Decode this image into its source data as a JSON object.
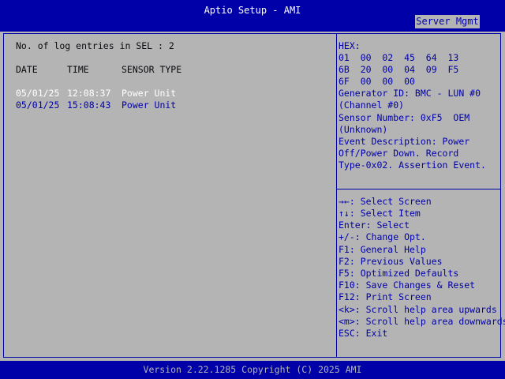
{
  "header": {
    "title": "Aptio Setup - AMI",
    "tab": "Server Mgmt"
  },
  "sel": {
    "count_label": "No. of log entries in SEL : 2",
    "columns": {
      "date": "DATE",
      "time": "TIME",
      "sensor": "SENSOR TYPE"
    },
    "entries": [
      {
        "date": "05/01/25",
        "time": "12:08:37",
        "sensor": "Power Unit"
      },
      {
        "date": "05/01/25",
        "time": "15:08:43",
        "sensor": "Power Unit"
      }
    ]
  },
  "details": {
    "lines": [
      "HEX:",
      "01  00  02  45  64  13",
      "6B  20  00  04  09  F5",
      "6F  00  00  00",
      "Generator ID: BMC - LUN #0",
      "(Channel #0)",
      "Sensor Number: 0xF5  OEM",
      "(Unknown)",
      "Event Description: Power",
      "Off/Power Down. Record",
      "Type-0x02. Assertion Event."
    ]
  },
  "keys": {
    "lines": [
      "→←: Select Screen",
      "↑↓: Select Item",
      "Enter: Select",
      "+/-: Change Opt.",
      "F1: General Help",
      "F2: Previous Values",
      "F5: Optimized Defaults",
      "F10: Save Changes & Reset",
      "F12: Print Screen",
      "<k>: Scroll help area upwards",
      "<m>: Scroll help area downwards",
      "ESC: Exit"
    ]
  },
  "footer": {
    "version": "Version 2.22.1285 Copyright (C) 2025 AMI"
  },
  "colors": {
    "bios_blue": "#0000a8",
    "panel_gray": "#b4b4b4",
    "selected_text": "#ffffff"
  }
}
